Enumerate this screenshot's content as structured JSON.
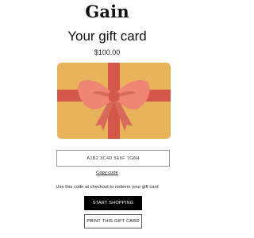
{
  "brand": {
    "name": "Gain"
  },
  "heading": {
    "title": "Your gift card",
    "amount": "$100.00"
  },
  "gift_card": {
    "image": "gift-card-with-bow",
    "colors": {
      "background": "#E8B35A",
      "ribbon": "#D4584A",
      "bow": "#EF8574",
      "bow_shadow": "#D86A5C"
    }
  },
  "code": {
    "value": "A1B2 3C4D 5E6F 7G8H",
    "copy_label": "Copy code"
  },
  "helper_text": "Use this code at checkout to redeem your gift card",
  "actions": {
    "start_shopping": "START SHOPPING",
    "print": "PRINT THIS GIFT CARD"
  }
}
